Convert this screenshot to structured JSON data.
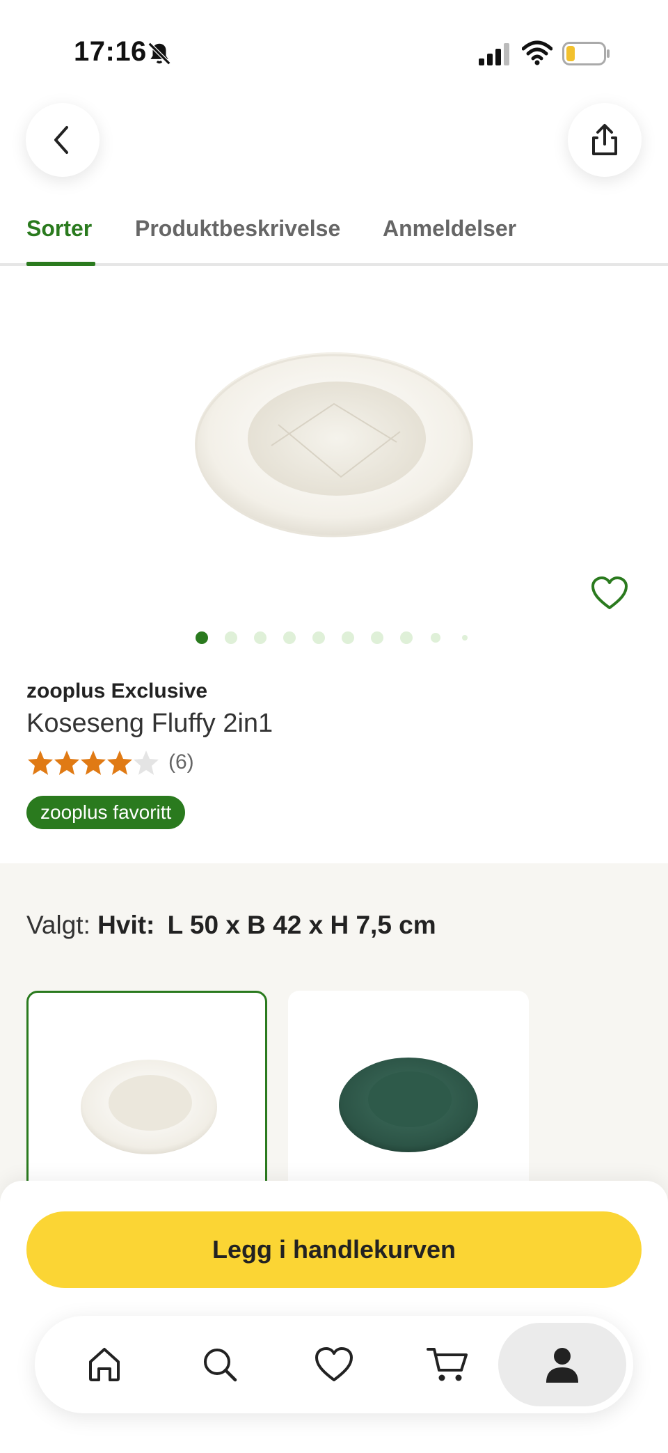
{
  "status_bar": {
    "time": "17:16"
  },
  "tabs": [
    {
      "label": "Sorter",
      "active": true
    },
    {
      "label": "Produktbeskrivelse",
      "active": false
    },
    {
      "label": "Anmeldelser",
      "active": false
    }
  ],
  "gallery": {
    "image_count": 10,
    "current_index": 1
  },
  "product": {
    "brand": "zooplus Exclusive",
    "name": "Koseseng Fluffy 2in1",
    "rating": 4,
    "rating_max": 5,
    "reviews": "(6)",
    "badge": "zooplus favoritt"
  },
  "variant": {
    "prefix": "Valgt:",
    "color": "Hvit:",
    "size": "L 50 x B 42 x H 7,5 cm",
    "options": [
      {
        "color_name": "white",
        "selected": true
      },
      {
        "color_name": "green",
        "selected": false
      }
    ]
  },
  "cta": {
    "add_to_cart": "Legg i handlekurven"
  },
  "nav": {
    "items": [
      {
        "icon": "home-icon"
      },
      {
        "icon": "search-icon"
      },
      {
        "icon": "heart-icon"
      },
      {
        "icon": "cart-icon"
      },
      {
        "icon": "profile-icon",
        "active": true
      }
    ]
  },
  "colors": {
    "accent_green": "#2a7a1e",
    "cta_yellow": "#fbd534",
    "star_orange": "#e07a14",
    "variant_bg": "#f7f6f2"
  }
}
